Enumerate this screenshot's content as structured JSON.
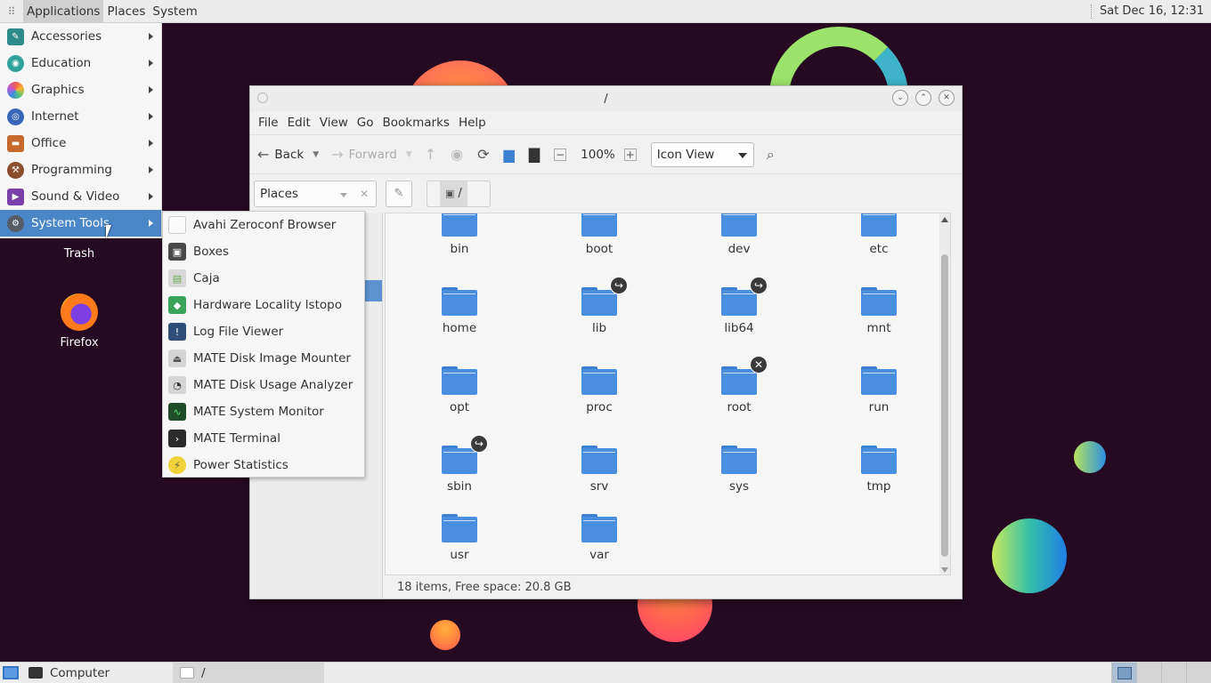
{
  "top_panel": {
    "menus": [
      "Applications",
      "Places",
      "System"
    ],
    "clock": "Sat Dec 16, 12:31"
  },
  "app_menu": {
    "items": [
      {
        "label": "Accessories",
        "icon": "accessories-icon",
        "color": "#2e8b8b"
      },
      {
        "label": "Education",
        "icon": "education-icon",
        "color": "#2fa39a"
      },
      {
        "label": "Graphics",
        "icon": "graphics-icon",
        "color": "#e05aa0"
      },
      {
        "label": "Internet",
        "icon": "internet-icon",
        "color": "#3866b8"
      },
      {
        "label": "Office",
        "icon": "office-icon",
        "color": "#c56a2c"
      },
      {
        "label": "Programming",
        "icon": "programming-icon",
        "color": "#8a4e2e"
      },
      {
        "label": "Sound & Video",
        "icon": "sound-video-icon",
        "color": "#7a3fa8"
      },
      {
        "label": "System Tools",
        "icon": "system-tools-icon",
        "color": "#555c66"
      }
    ],
    "selected": "System Tools"
  },
  "sub_menu": {
    "items": [
      {
        "label": "Avahi Zeroconf Browser",
        "icon": "avahi-icon"
      },
      {
        "label": "Boxes",
        "icon": "boxes-icon"
      },
      {
        "label": "Caja",
        "icon": "caja-icon"
      },
      {
        "label": "Hardware Locality lstopo",
        "icon": "lstopo-icon"
      },
      {
        "label": "Log File Viewer",
        "icon": "log-viewer-icon"
      },
      {
        "label": "MATE Disk Image Mounter",
        "icon": "disk-mounter-icon"
      },
      {
        "label": "MATE Disk Usage Analyzer",
        "icon": "disk-usage-icon"
      },
      {
        "label": "MATE System Monitor",
        "icon": "system-monitor-icon"
      },
      {
        "label": "MATE Terminal",
        "icon": "terminal-icon"
      },
      {
        "label": "Power Statistics",
        "icon": "power-stats-icon"
      }
    ]
  },
  "desktop": {
    "icons": [
      {
        "label": "Trash"
      },
      {
        "label": "Firefox"
      }
    ]
  },
  "window": {
    "title": "/",
    "menus": [
      "File",
      "Edit",
      "View",
      "Go",
      "Bookmarks",
      "Help"
    ],
    "toolbar": {
      "back": "Back",
      "forward": "Forward",
      "zoom": "100%",
      "view_mode": "Icon View"
    },
    "location": {
      "places_label": "Places",
      "path": "/"
    },
    "files": [
      {
        "name": "bin",
        "emblem": ""
      },
      {
        "name": "boot",
        "emblem": ""
      },
      {
        "name": "dev",
        "emblem": ""
      },
      {
        "name": "etc",
        "emblem": ""
      },
      {
        "name": "home",
        "emblem": ""
      },
      {
        "name": "lib",
        "emblem": "link"
      },
      {
        "name": "lib64",
        "emblem": "link"
      },
      {
        "name": "mnt",
        "emblem": ""
      },
      {
        "name": "opt",
        "emblem": ""
      },
      {
        "name": "proc",
        "emblem": ""
      },
      {
        "name": "root",
        "emblem": "unreadable"
      },
      {
        "name": "run",
        "emblem": ""
      },
      {
        "name": "sbin",
        "emblem": "link"
      },
      {
        "name": "srv",
        "emblem": ""
      },
      {
        "name": "sys",
        "emblem": ""
      },
      {
        "name": "tmp",
        "emblem": ""
      },
      {
        "name": "usr",
        "emblem": ""
      },
      {
        "name": "var",
        "emblem": ""
      }
    ],
    "status": "18 items, Free space: 20.8 GB"
  },
  "bottom_panel": {
    "tasks": [
      {
        "label": "Computer"
      },
      {
        "label": "/"
      }
    ]
  }
}
